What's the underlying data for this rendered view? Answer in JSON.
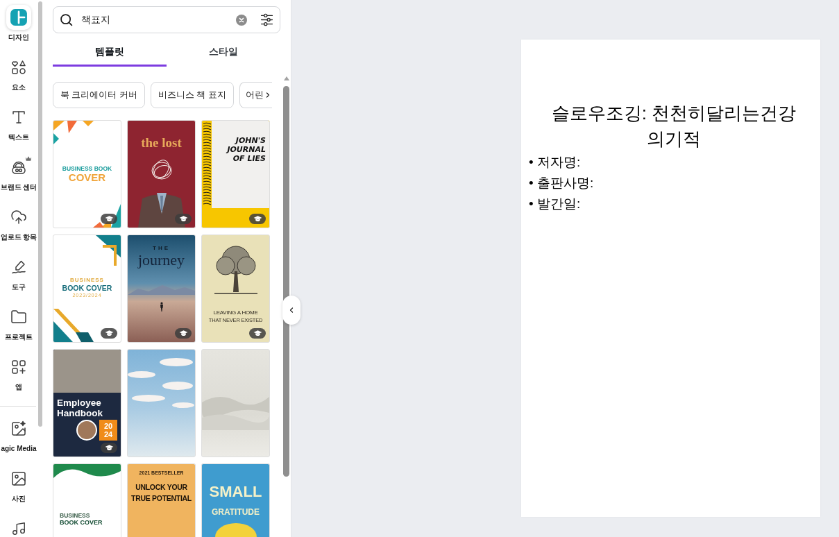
{
  "sidebar": {
    "items": [
      {
        "label": "디자인",
        "selected": true,
        "premium": false
      },
      {
        "label": "요소",
        "selected": false,
        "premium": false
      },
      {
        "label": "텍스트",
        "selected": false,
        "premium": false
      },
      {
        "label": "브랜드 센터",
        "selected": false,
        "premium": true
      },
      {
        "label": "업로드 항목",
        "selected": false,
        "premium": false
      },
      {
        "label": "도구",
        "selected": false,
        "premium": false
      },
      {
        "label": "프로젝트",
        "selected": false,
        "premium": false
      },
      {
        "label": "앱",
        "selected": false,
        "premium": false
      }
    ],
    "more_items": [
      {
        "label": "agic Media",
        "selected": false
      },
      {
        "label": "사진",
        "selected": false
      },
      {
        "selected": false
      }
    ]
  },
  "search": {
    "value": "책표지"
  },
  "tabs": [
    {
      "label": "템플릿",
      "selected": true
    },
    {
      "label": "스타일",
      "selected": false
    }
  ],
  "chips": [
    "북 크리에이터 커버",
    "비즈니스 책 표지",
    "어린"
  ],
  "templates": [
    {
      "kind": "triangles",
      "lines": [
        "BUSINESS BOOK",
        "COVER"
      ],
      "education": true
    },
    {
      "kind": "suit",
      "lines": [
        "the lost"
      ],
      "education": true
    },
    {
      "kind": "notebook",
      "lines": [
        "JOHN'S",
        "JOURNAL",
        "OF LIES"
      ],
      "education": true
    },
    {
      "kind": "frames",
      "lines": [
        "BUSINESS",
        "BOOK COVER",
        "2023/2024"
      ],
      "education": true
    },
    {
      "kind": "desert",
      "lines": [
        "THE",
        "journey"
      ],
      "education": true
    },
    {
      "kind": "tree",
      "lines": [
        "LEAVING A HOME",
        "THAT NEVER EXISTED"
      ],
      "education": true
    },
    {
      "kind": "team",
      "lines": [
        "Employee",
        "Handbook",
        "20",
        "24"
      ],
      "education": true
    },
    {
      "kind": "sky",
      "education": false
    },
    {
      "kind": "mist",
      "education": false
    },
    {
      "kind": "green",
      "lines": [
        "BUSINESS",
        "BOOK COVER"
      ]
    },
    {
      "kind": "sunburst",
      "lines": [
        "2021 BESTSELLER",
        "UNLOCK YOUR",
        "TRUE POTENTIAL"
      ]
    },
    {
      "kind": "blue",
      "lines": [
        "SMALL",
        "GRATITUDE"
      ]
    }
  ],
  "canvas": {
    "title": "슬로우조깅: 천천히달리는건강의기적",
    "bullets": [
      "• 저자명:",
      "• 출판사명:",
      "• 발간일:"
    ]
  }
}
